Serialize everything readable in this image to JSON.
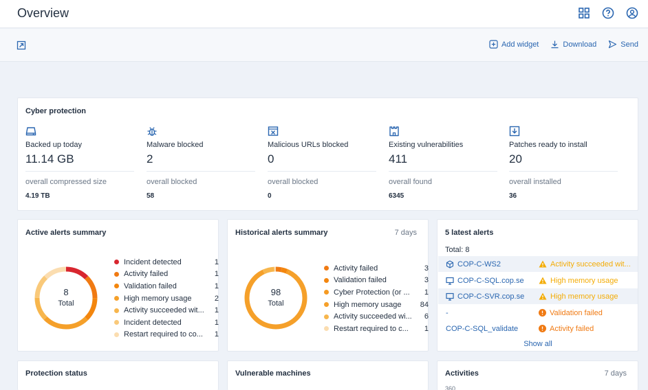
{
  "header": {
    "title": "Overview",
    "icons": [
      "grid-icon",
      "help-icon",
      "account-icon"
    ]
  },
  "toolbar": {
    "add_widget": "Add widget",
    "download": "Download",
    "send": "Send"
  },
  "cyber_protection": {
    "title": "Cyber protection",
    "columns": [
      {
        "icon": "drive-icon",
        "label": "Backed up today",
        "value": "11.14 GB",
        "sublabel": "overall compressed size",
        "subvalue": "4.19 TB"
      },
      {
        "icon": "bug-icon",
        "label": "Malware blocked",
        "value": "2",
        "sublabel": "overall blocked",
        "subvalue": "58"
      },
      {
        "icon": "blocked-url-icon",
        "label": "Malicious URLs blocked",
        "value": "0",
        "sublabel": "overall blocked",
        "subvalue": "0"
      },
      {
        "icon": "castle-icon",
        "label": "Existing vulnerabilities",
        "value": "411",
        "sublabel": "overall found",
        "subvalue": "6345"
      },
      {
        "icon": "patch-download-icon",
        "label": "Patches ready to install",
        "value": "20",
        "sublabel": "overall installed",
        "subvalue": "36"
      }
    ]
  },
  "active_alerts": {
    "title": "Active alerts summary",
    "total_value": "8",
    "total_label": "Total",
    "items": [
      {
        "label": "Incident detected",
        "count": "1",
        "color": "#d8262f"
      },
      {
        "label": "Activity failed",
        "count": "1",
        "color": "#f07a13"
      },
      {
        "label": "Validation failed",
        "count": "1",
        "color": "#f3860e"
      },
      {
        "label": "High memory usage",
        "count": "2",
        "color": "#f5a02a"
      },
      {
        "label": "Activity succeeded wit...",
        "count": "1",
        "color": "#f7b64d"
      },
      {
        "label": "Incident detected",
        "count": "1",
        "color": "#f9c97a"
      },
      {
        "label": "Restart required to co...",
        "count": "1",
        "color": "#fbddb0"
      }
    ]
  },
  "historical_alerts": {
    "title": "Historical alerts summary",
    "period": "7 days",
    "total_value": "98",
    "total_label": "Total",
    "items": [
      {
        "label": "Activity failed",
        "count": "3",
        "color": "#f07a13"
      },
      {
        "label": "Validation failed",
        "count": "3",
        "color": "#f3860e"
      },
      {
        "label": "Cyber Protection (or ...",
        "count": "1",
        "color": "#f59a22"
      },
      {
        "label": "High memory usage",
        "count": "84",
        "color": "#f5a02a"
      },
      {
        "label": "Activity succeeded wi...",
        "count": "6",
        "color": "#f7b64d"
      },
      {
        "label": "Restart required to c...",
        "count": "1",
        "color": "#fbddb0"
      }
    ]
  },
  "latest_alerts": {
    "title": "5 latest alerts",
    "total": "Total: 8",
    "rows": [
      {
        "machine": "COP-C-WS2",
        "machine_icon": "box-icon",
        "alert": "Activity succeeded wit...",
        "severity": "warning"
      },
      {
        "machine": "COP-C-SQL.cop.se",
        "machine_icon": "monitor-icon",
        "alert": "High memory usage",
        "severity": "warning"
      },
      {
        "machine": "COP-C-SVR.cop.se",
        "machine_icon": "monitor-icon",
        "alert": "High memory usage",
        "severity": "warning"
      },
      {
        "machine": "-",
        "machine_icon": "",
        "alert": "Validation failed",
        "severity": "error"
      },
      {
        "machine": "COP-C-SQL_validate",
        "machine_icon": "",
        "alert": "Activity failed",
        "severity": "error"
      }
    ],
    "show_all": "Show all"
  },
  "bottom_cards": {
    "protection_status": "Protection status",
    "vulnerable_machines": "Vulnerable machines",
    "activities": "Activities",
    "activities_period": "7 days",
    "activities_axis_top": "360"
  },
  "colors": {
    "accent": "#2a66b0",
    "warning": "#f3ac07",
    "error": "#f07a13",
    "critical": "#d8262f"
  }
}
